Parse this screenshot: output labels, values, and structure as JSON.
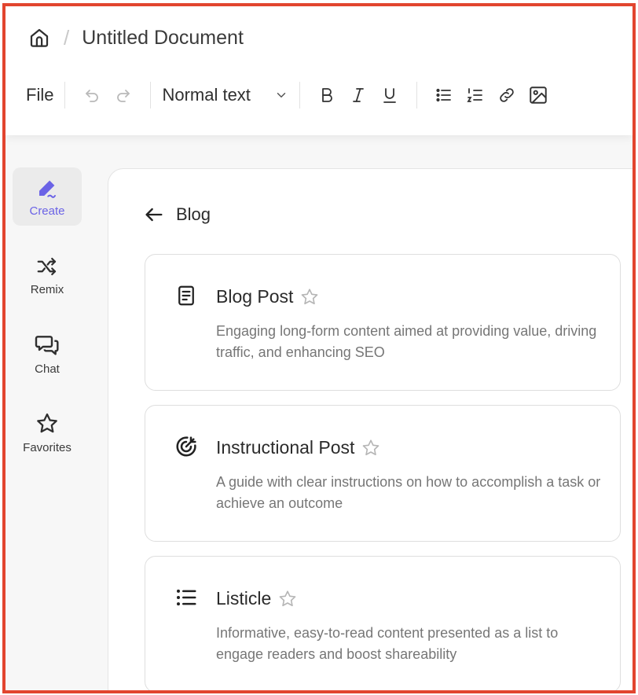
{
  "header": {
    "separator": "/",
    "document_title": "Untitled Document"
  },
  "toolbar": {
    "file_label": "File",
    "text_style": "Normal text",
    "icons": [
      "undo-icon",
      "redo-icon",
      "chevron-down-icon",
      "bold-icon",
      "italic-icon",
      "underline-icon",
      "bullet-list-icon",
      "numbered-list-icon",
      "link-icon",
      "image-icon"
    ]
  },
  "sidebar": {
    "items": [
      {
        "label": "Create",
        "icon": "pen-icon",
        "active": true
      },
      {
        "label": "Remix",
        "icon": "shuffle-icon",
        "active": false
      },
      {
        "label": "Chat",
        "icon": "chat-icon",
        "active": false
      },
      {
        "label": "Favorites",
        "icon": "star-icon",
        "active": false
      }
    ]
  },
  "main": {
    "back_label": "Blog",
    "cards": [
      {
        "title": "Blog Post",
        "icon": "document-icon",
        "description": "Engaging long-form content aimed at providing value, driving traffic, and enhancing SEO"
      },
      {
        "title": "Instructional Post",
        "icon": "target-icon",
        "description": "A guide with clear instructions on how to accomplish a task or achieve an outcome"
      },
      {
        "title": "Listicle",
        "icon": "list-icon",
        "description": "Informative, easy-to-read content presented as a list to engage readers and boost shareability"
      }
    ]
  },
  "colors": {
    "accent": "#6b63e6",
    "frame_border": "#e2452f",
    "active_item_bg": "#ebebeb",
    "muted_text": "#767676"
  }
}
